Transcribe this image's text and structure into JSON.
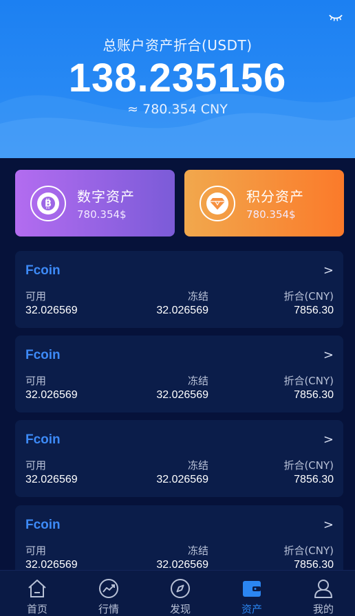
{
  "header": {
    "title": "总账户资产折合(USDT)",
    "amount": "138.235156",
    "cny": "≈ 780.354 CNY",
    "eye_icon": "eye-closed-icon"
  },
  "asset_cards": [
    {
      "title": "数字资产",
      "value": "780.354$",
      "icon": "bitcoin-icon",
      "colors": [
        "#b36cf0",
        "#7b5bd8"
      ]
    },
    {
      "title": "积分资产",
      "value": "780.354$",
      "icon": "diamond-icon",
      "colors": [
        "#f1a84d",
        "#fb7a2a"
      ]
    }
  ],
  "coins": [
    {
      "name": "Fcoin",
      "chevron": ">",
      "available_label": "可用",
      "available": "32.026569",
      "frozen_label": "冻结",
      "frozen": "32.026569",
      "value_label": "折合(CNY)",
      "value": "7856.30"
    },
    {
      "name": "Fcoin",
      "chevron": ">",
      "available_label": "可用",
      "available": "32.026569",
      "frozen_label": "冻结",
      "frozen": "32.026569",
      "value_label": "折合(CNY)",
      "value": "7856.30"
    },
    {
      "name": "Fcoin",
      "chevron": ">",
      "available_label": "可用",
      "available": "32.026569",
      "frozen_label": "冻结",
      "frozen": "32.026569",
      "value_label": "折合(CNY)",
      "value": "7856.30"
    },
    {
      "name": "Fcoin",
      "chevron": ">",
      "available_label": "可用",
      "available": "32.026569",
      "frozen_label": "冻结",
      "frozen": "32.026569",
      "value_label": "折合(CNY)",
      "value": "7856.30"
    }
  ],
  "tabbar": {
    "items": [
      {
        "label": "首页",
        "icon": "home-icon"
      },
      {
        "label": "行情",
        "icon": "trend-icon"
      },
      {
        "label": "发现",
        "icon": "compass-icon"
      },
      {
        "label": "资产",
        "icon": "wallet-icon",
        "active": true
      },
      {
        "label": "我的",
        "icon": "user-icon"
      }
    ]
  },
  "colors": {
    "primary": "#2b86f2",
    "background": "#06123a",
    "card": "#0b1d4a"
  }
}
